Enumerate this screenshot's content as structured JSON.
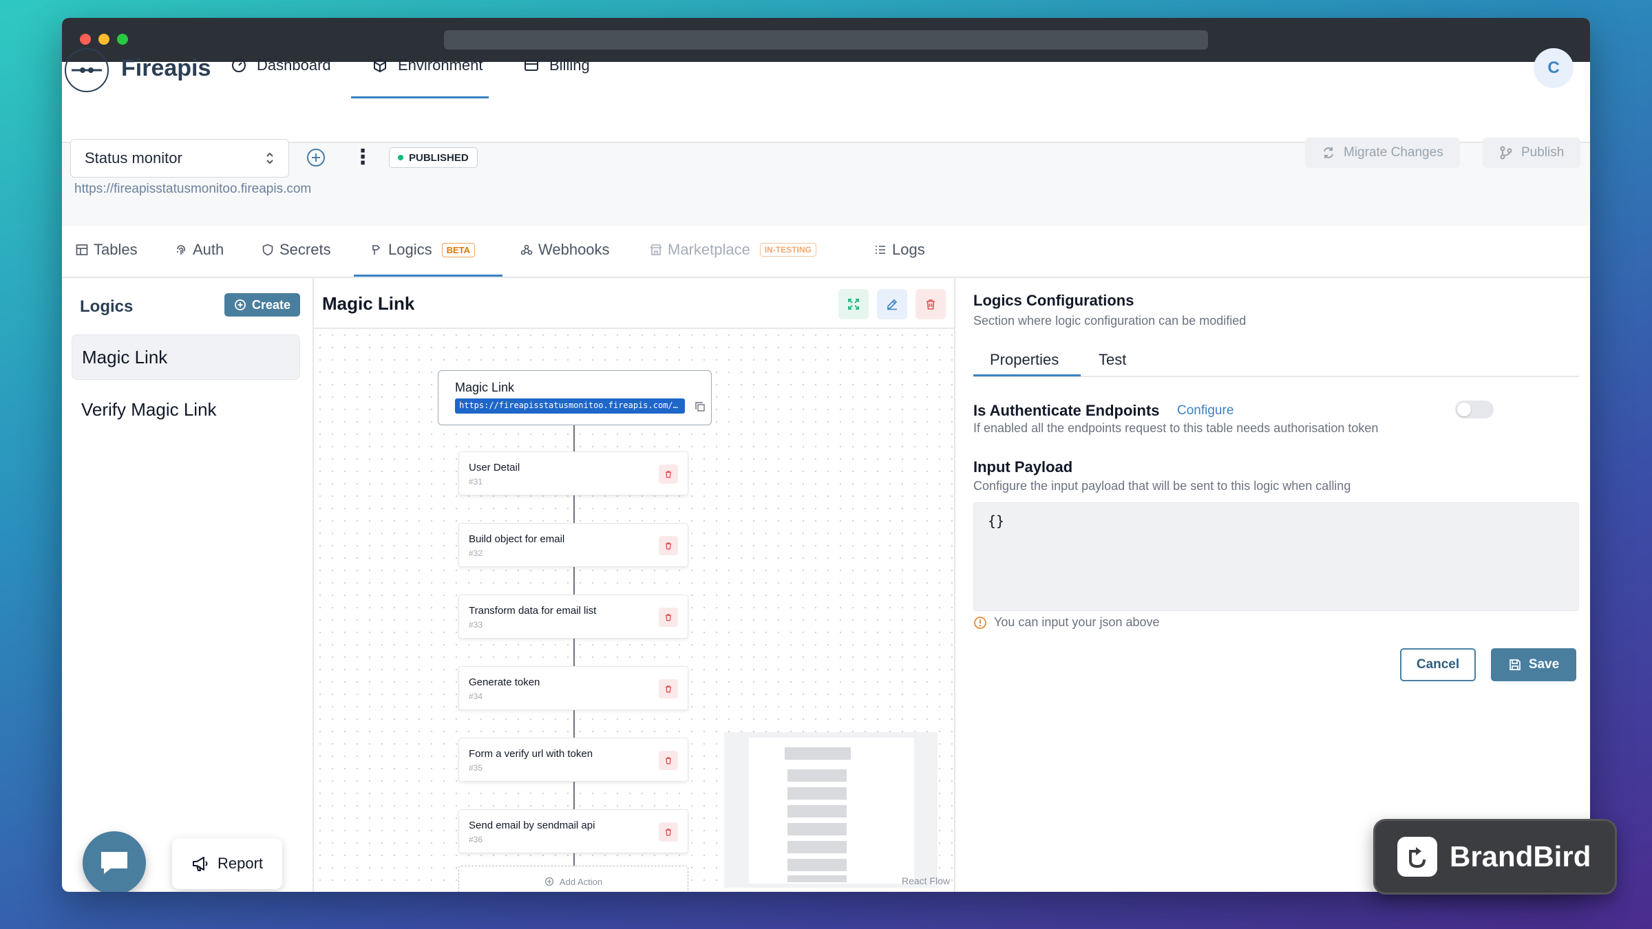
{
  "brand": {
    "name": "Fireapis",
    "avatar_initial": "C"
  },
  "topnav": [
    {
      "label": "Dashboard",
      "icon": "gauge-icon"
    },
    {
      "label": "Environment",
      "icon": "cube-icon",
      "active": true
    },
    {
      "label": "Billing",
      "icon": "card-icon"
    }
  ],
  "project": {
    "selected": "Status monitor",
    "url": "https://fireapisstatusmonitoo.fireapis.com",
    "status_badge": "PUBLISHED",
    "migrate_label": "Migrate Changes",
    "publish_label": "Publish"
  },
  "tabs": [
    {
      "label": "Tables",
      "icon": "table-icon"
    },
    {
      "label": "Auth",
      "icon": "fingerprint-icon"
    },
    {
      "label": "Secrets",
      "icon": "shield-icon"
    },
    {
      "label": "Logics",
      "icon": "logic-icon",
      "badge": "BETA",
      "active": true
    },
    {
      "label": "Webhooks",
      "icon": "webhook-icon"
    },
    {
      "label": "Marketplace",
      "icon": "store-icon",
      "badge": "IN-TESTING",
      "disabled": true
    },
    {
      "label": "Logs",
      "icon": "list-icon"
    }
  ],
  "logics": {
    "title": "Logics",
    "create_label": "Create",
    "items": [
      "Magic Link",
      "Verify Magic Link"
    ],
    "selected": "Magic Link"
  },
  "canvas": {
    "title": "Magic Link",
    "root_title": "Magic Link",
    "root_url": "https://fireapisstatusmonitoo.fireapis.com/magic-link",
    "steps": [
      {
        "name": "User Detail",
        "id": "#31"
      },
      {
        "name": "Build object for email",
        "id": "#32"
      },
      {
        "name": "Transform data for email list",
        "id": "#33"
      },
      {
        "name": "Generate token",
        "id": "#34"
      },
      {
        "name": "Form a verify url with token",
        "id": "#35"
      },
      {
        "name": "Send email by sendmail api",
        "id": "#36"
      }
    ],
    "add_action_label": "Add Action",
    "react_flow_label": "React Flow"
  },
  "config": {
    "title": "Logics Configurations",
    "subtitle": "Section where logic configuration can be modified",
    "tab_properties": "Properties",
    "tab_test": "Test",
    "auth_title": "Is Authenticate Endpoints",
    "auth_link": "Configure",
    "auth_sub": "If enabled all the endpoints request to this table needs authorisation token",
    "payload_title": "Input Payload",
    "payload_sub": "Configure the input payload that will be sent to this logic when calling",
    "payload_value": "{}",
    "hint": "You can input your json above",
    "cancel_label": "Cancel",
    "save_label": "Save"
  },
  "support": {
    "report_label": "Report"
  },
  "watermark": {
    "text": "BrandBird"
  },
  "colors": {
    "accent": "#3b82c4",
    "primary_btn": "#4a7e9f",
    "danger": "#e05252",
    "success": "#10b981"
  }
}
